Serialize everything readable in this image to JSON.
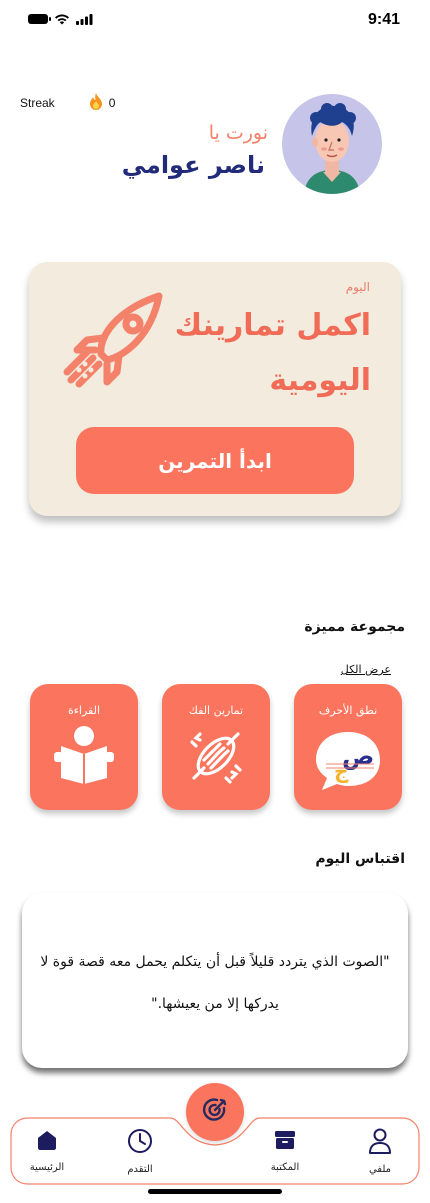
{
  "status_bar": {
    "time": "9:41"
  },
  "header": {
    "streak_label": "Streak",
    "streak_count": "0",
    "greeting": "نورت يا",
    "username": "ناصر عوامي"
  },
  "daily": {
    "kicker": "اليوم",
    "title": "اكمل تمارينك اليومية",
    "button_label": "ابدأ التمرين"
  },
  "featured": {
    "title": "مجموعة مميزة",
    "view_all": "عرض الكل",
    "tiles": [
      {
        "label": "نطق الأحرف",
        "icon": "letters-speech-icon"
      },
      {
        "label": "تمارين الفك",
        "icon": "jaw-muscle-icon"
      },
      {
        "label": "القراءة",
        "icon": "reading-person-icon"
      }
    ]
  },
  "quote": {
    "title": "اقتباس اليوم",
    "text": "\"الصوت الذي يتردد قليلاً قبل أن يتكلم يحمل معه قصة قوة لا يدركها إلا من يعيشها.\""
  },
  "nav": {
    "items": [
      {
        "label": "الرئيسية",
        "icon": "home-icon"
      },
      {
        "label": "التقدم",
        "icon": "clock-icon"
      },
      {
        "label": "المكتبة",
        "icon": "archive-icon"
      },
      {
        "label": "ملفي",
        "icon": "user-icon"
      }
    ],
    "center_icon": "target-icon"
  },
  "colors": {
    "accent": "#fb745d",
    "card_bg": "#f3ebde",
    "username": "#222a7a",
    "nav_active": "#1c1c5e"
  }
}
